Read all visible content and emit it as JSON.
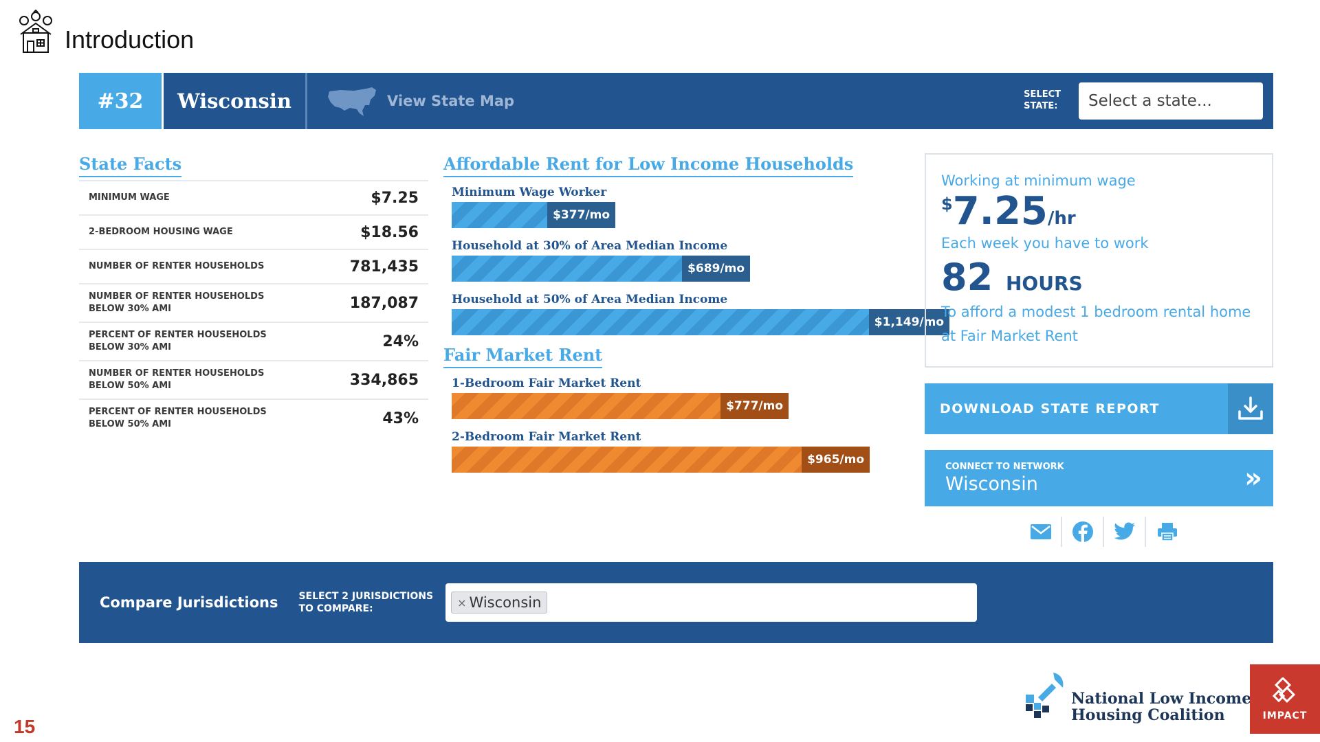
{
  "slide": {
    "title": "Introduction",
    "page_number": "15"
  },
  "topbar": {
    "rank": "#32",
    "state": "Wisconsin",
    "map_link": "View State Map",
    "select_label_line1": "SELECT",
    "select_label_line2": "STATE:",
    "select_placeholder": "Select a state..."
  },
  "state_facts": {
    "title": "State Facts",
    "rows": [
      {
        "label": "MINIMUM WAGE",
        "value": "$7.25"
      },
      {
        "label": "2-BEDROOM HOUSING WAGE",
        "value": "$18.56"
      },
      {
        "label": "NUMBER OF RENTER HOUSEHOLDS",
        "value": "781,435"
      },
      {
        "label": "NUMBER OF RENTER HOUSEHOLDS\nBELOW 30% AMI",
        "value": "187,087"
      },
      {
        "label": "PERCENT OF RENTER HOUSEHOLDS\nBELOW 30% AMI",
        "value": "24%"
      },
      {
        "label": "NUMBER OF RENTER HOUSEHOLDS\nBELOW 50% AMI",
        "value": "334,865"
      },
      {
        "label": "PERCENT OF RENTER HOUSEHOLDS\nBELOW 50% AMI",
        "value": "43%"
      }
    ]
  },
  "affordable_rent": {
    "title": "Affordable Rent for Low Income Households",
    "bars": [
      {
        "label": "Minimum Wage Worker",
        "value": 377,
        "tag": "$377/mo"
      },
      {
        "label": "Household at 30% of Area Median Income",
        "value": 689,
        "tag": "$689/mo"
      },
      {
        "label": "Household at 50% of Area Median Income",
        "value": 1149,
        "tag": "$1,149/mo"
      }
    ]
  },
  "fair_market_rent": {
    "title": "Fair Market Rent",
    "bars": [
      {
        "label": "1-Bedroom Fair Market Rent",
        "value": 777,
        "tag": "$777/mo"
      },
      {
        "label": "2-Bedroom Fair Market Rent",
        "value": 965,
        "tag": "$965/mo"
      }
    ]
  },
  "wage_card": {
    "line1": "Working at minimum wage",
    "wage_currency": "$",
    "wage_amount": "7.25",
    "wage_unit": "/hr",
    "line2": "Each week you have to work",
    "hours_value": "82",
    "hours_unit": "HOURS",
    "line3": "To afford a modest 1 bedroom rental home",
    "line4": "at Fair Market Rent"
  },
  "download": {
    "label": "DOWNLOAD STATE REPORT"
  },
  "network": {
    "small_label": "CONNECT TO NETWORK",
    "state": "Wisconsin",
    "chevron": "»"
  },
  "share_icons": [
    "email-icon",
    "facebook-icon",
    "twitter-icon",
    "print-icon"
  ],
  "compare": {
    "title": "Compare Jurisdictions",
    "select_line1": "SELECT 2 JURISDICTIONS",
    "select_line2": "TO COMPARE:",
    "chip_remove": "×",
    "chip": "Wisconsin"
  },
  "logos": {
    "nlihc_line1": "National Low Income",
    "nlihc_line2": "Housing Coalition",
    "impact": "IMPACT"
  },
  "colors": {
    "navy": "#22558f",
    "light_blue": "#47a9e6",
    "orange": "#f08a30",
    "dark_orange": "#a14f16",
    "accent_red": "#c9392e"
  }
}
